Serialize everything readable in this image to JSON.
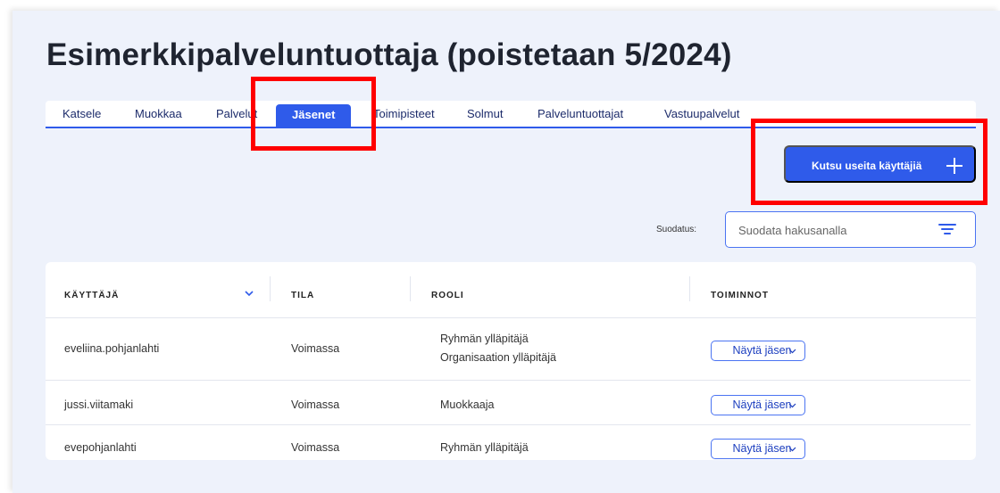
{
  "page": {
    "title": "Esimerkkipalveluntuottaja (poistetaan 5/2024)"
  },
  "tabs": [
    {
      "label": "Katsele"
    },
    {
      "label": "Muokkaa"
    },
    {
      "label": "Palvelut"
    },
    {
      "label": "Jäsenet",
      "active": true
    },
    {
      "label": "Toimipisteet"
    },
    {
      "label": "Solmut"
    },
    {
      "label": "Palveluntuottajat"
    },
    {
      "label": "Vastuupalvelut"
    }
  ],
  "actions": {
    "invite_label": "Kutsu useita käyttäjiä",
    "invite_icon": "plus-icon"
  },
  "filter": {
    "label": "Suodatus:",
    "placeholder": "Suodata hakusanalla",
    "icon": "filter-icon"
  },
  "table": {
    "headers": [
      "KÄYTTÄJÄ",
      "TILA",
      "ROOLI",
      "TOIMINNOT"
    ],
    "sort_icon": "chevron-down-icon",
    "rows": [
      {
        "user": "eveliina.pohjanlahti",
        "status": "Voimassa",
        "roles": [
          "Ryhmän ylläpitäjä",
          "Organisaation ylläpitäjä"
        ],
        "action": "Näytä jäsen"
      },
      {
        "user": "jussi.viitamaki",
        "status": "Voimassa",
        "roles": [
          "Muokkaaja"
        ],
        "action": "Näytä jäsen"
      },
      {
        "user": "evepohjanlahti",
        "status": "Voimassa",
        "roles": [
          "Ryhmän ylläpitäjä"
        ],
        "action": "Näytä jäsen"
      }
    ]
  },
  "colors": {
    "accent": "#2f5bea",
    "highlight": "#ff0000",
    "background": "#eef2fb"
  }
}
